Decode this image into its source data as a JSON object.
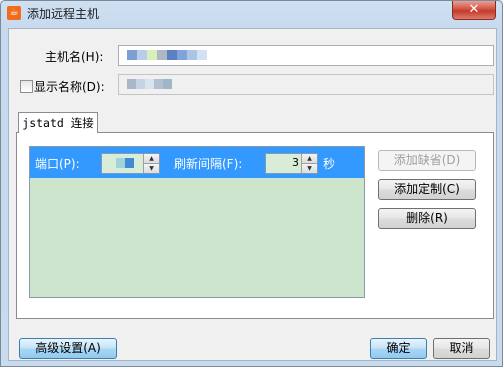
{
  "window": {
    "title": "添加远程主机",
    "close_glyph": "✕",
    "app_icon": "java-coffee-icon"
  },
  "host": {
    "label": "主机名(H):",
    "value_colors": [
      "#7d9fd4",
      "#b8cde9",
      "#d8efb8",
      "#aeb8c4",
      "#5d7fc6",
      "#7fa4d9",
      "#aac5e6",
      "#d2e2f2"
    ]
  },
  "display_name": {
    "checkbox_label": "显示名称(D):",
    "checked": false,
    "value_colors": [
      "#a9b7c8",
      "#c5d3e2",
      "#d9e4ee",
      "#b1c1d2",
      "#9fb5ca"
    ]
  },
  "tab": {
    "label": "jstatd 连接"
  },
  "connection": {
    "port_label": "端口(P):",
    "port_value_colors": [
      "#9fd3d8",
      "#3f8bd8"
    ],
    "refresh_label": "刷新间隔(F):",
    "refresh_value": "3",
    "refresh_unit": "秒"
  },
  "side_buttons": {
    "add_default": "添加缺省(D)",
    "add_custom": "添加定制(C)",
    "delete": "删除(R)"
  },
  "footer": {
    "advanced": "高级设置(A)",
    "ok": "确定",
    "cancel": "取消"
  }
}
